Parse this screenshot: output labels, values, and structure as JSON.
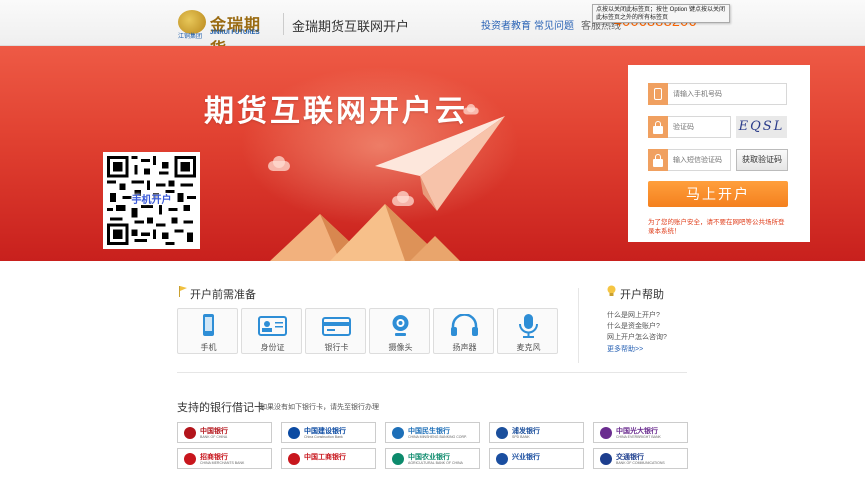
{
  "header": {
    "logo": {
      "cn": "金瑞期货",
      "en": "JINRUI FUTURES",
      "group": "江铜集团"
    },
    "site_title": "金瑞期货互联网开户",
    "nav": [
      "投资者教育",
      "常见问题"
    ],
    "service_label": "客服热线",
    "phone": "4006888206",
    "tooltip": "点按以关闭此标签页；按住 Option 键点按以关闭此标签页之外的所有标签页"
  },
  "banner": {
    "title": "期货互联网开户云",
    "qr_caption": "手机开户"
  },
  "form": {
    "phone_placeholder": "请输入手机号码",
    "captcha_placeholder": "验证码",
    "captcha_text": "EQSL",
    "sms_placeholder": "输入短信验证码",
    "get_code_label": "获取验证码",
    "submit_label": "马上开户",
    "warning": "为了您的账户安全，请不要在网吧等公共场所登录本系统！"
  },
  "prep": {
    "title": "开户前需准备",
    "items": [
      {
        "label": "手机",
        "icon": "phone-icon"
      },
      {
        "label": "身份证",
        "icon": "id-card-icon"
      },
      {
        "label": "银行卡",
        "icon": "bank-card-icon"
      },
      {
        "label": "摄像头",
        "icon": "webcam-icon"
      },
      {
        "label": "扬声器",
        "icon": "headphones-icon"
      },
      {
        "label": "麦克风",
        "icon": "microphone-icon"
      }
    ]
  },
  "help": {
    "title": "开户帮助",
    "links": [
      "什么是网上开户?",
      "什么是资金账户?",
      "网上开户怎么咨询?"
    ],
    "more": "更多帮助>>"
  },
  "banks": {
    "title": "支持的银行借记卡",
    "subtitle": "如果没有如下银行卡，请先至银行办理",
    "items": [
      {
        "name": "中国银行",
        "sub": "BANK OF CHINA",
        "color": "#b3141b"
      },
      {
        "name": "中国建设银行",
        "sub": "China Construction Bank",
        "color": "#0b4aa2"
      },
      {
        "name": "中国民生银行",
        "sub": "CHINA MINSHENG BANKING CORP.",
        "color": "#1d6fb8"
      },
      {
        "name": "浦发银行",
        "sub": "SPD BANK",
        "color": "#1b4f9c"
      },
      {
        "name": "中国光大银行",
        "sub": "CHINA EVERBRIGHT BANK",
        "color": "#6a2c8f"
      },
      {
        "name": "招商银行",
        "sub": "CHINA MERCHANTS BANK",
        "color": "#c8161d"
      },
      {
        "name": "中国工商银行",
        "sub": "",
        "color": "#c8161d"
      },
      {
        "name": "中国农业银行",
        "sub": "AGRICULTURAL BANK OF CHINA",
        "color": "#0c8a6c"
      },
      {
        "name": "兴业银行",
        "sub": "",
        "color": "#1a4ea0"
      },
      {
        "name": "交通银行",
        "sub": "BANK OF COMMUNICATIONS",
        "color": "#1d3e8e"
      }
    ]
  }
}
